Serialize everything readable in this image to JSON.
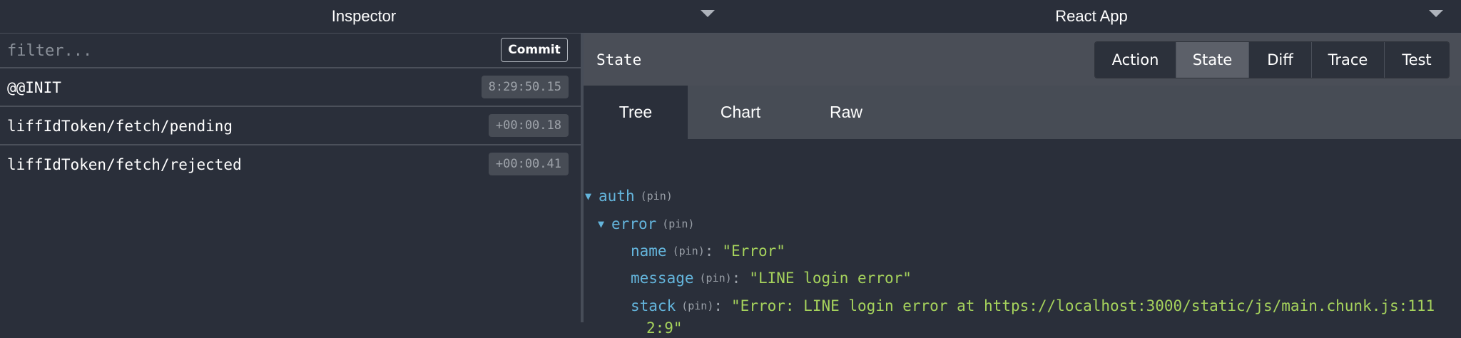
{
  "header": {
    "left_selector": "Inspector",
    "right_selector": "React App"
  },
  "left_panel": {
    "filter_placeholder": "filter...",
    "commit_label": "Commit",
    "actions": [
      {
        "name": "@@INIT",
        "time": "8:29:50.15"
      },
      {
        "name": "liffIdToken/fetch/pending",
        "time": "+00:00.18"
      },
      {
        "name": "liffIdToken/fetch/rejected",
        "time": "+00:00.41"
      }
    ]
  },
  "right_panel": {
    "title": "State",
    "monitor_buttons": [
      "Action",
      "State",
      "Diff",
      "Trace",
      "Test"
    ],
    "active_monitor": "State",
    "tabs": [
      "Tree",
      "Chart",
      "Raw"
    ],
    "active_tab": "Tree",
    "tree": {
      "pin_label": "(pin)",
      "auth_key": "auth",
      "error_key": "error",
      "name_key": "name",
      "name_value": "\"Error\"",
      "message_key": "message",
      "message_value": "\"LINE login error\"",
      "stack_key": "stack",
      "stack_value_line1": "\"Error: LINE login error at https://localhost:3000/static/js/main.chunk.js:111",
      "stack_value_line2": "2:9\""
    }
  },
  "colors": {
    "background": "#2a2f3a",
    "header_bar": "#4a4e57",
    "key": "#64b5dc",
    "string": "#a6d35c"
  }
}
